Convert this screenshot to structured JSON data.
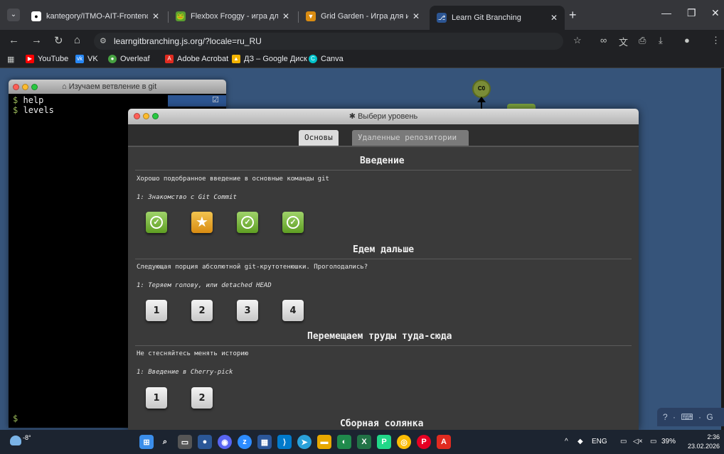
{
  "browser": {
    "tabs": [
      {
        "title": "kantegory/ITMO-AIT-Frontend",
        "icon": "github-icon"
      },
      {
        "title": "Flexbox Froggy - игра для изуч",
        "icon": "frog-icon"
      },
      {
        "title": "Grid Garden - Игра для изучен",
        "icon": "carrot-icon"
      },
      {
        "title": "Learn Git Branching",
        "icon": "git-branching-icon",
        "active": true
      }
    ],
    "url": "learngitbranching.js.org/?locale=ru_RU",
    "bookmarks": [
      {
        "label": "YouTube",
        "icon": "youtube-icon",
        "color": "#ff0000"
      },
      {
        "label": "VK",
        "icon": "vk-icon",
        "color": "#2787f5"
      },
      {
        "label": "Overleaf",
        "icon": "overleaf-icon",
        "color": "#47a141"
      },
      {
        "label": "Adobe Acrobat",
        "icon": "acrobat-icon",
        "color": "#e02b20"
      },
      {
        "label": "ДЗ – Google Диск",
        "icon": "google-drive-icon",
        "color": "#f4b400"
      },
      {
        "label": "Canva",
        "icon": "canva-icon",
        "color": "#00c4cc"
      }
    ]
  },
  "terminal": {
    "title": "Изучаем ветвление в git",
    "lines": [
      "help",
      "levels"
    ],
    "prompt": "$"
  },
  "visualization": {
    "commit_label": "C0"
  },
  "modal": {
    "title": "Выбери уровень",
    "tabs": {
      "main": "Основы",
      "remote": "Удаленные репозитории"
    },
    "sections": [
      {
        "title": "Введение",
        "description": "Хорошо подобранное введение в основные команды git",
        "current_level": "1: Знакомство с Git Commit",
        "levels": [
          {
            "state": "done",
            "label": ""
          },
          {
            "state": "star",
            "label": ""
          },
          {
            "state": "done",
            "label": ""
          },
          {
            "state": "done",
            "label": ""
          }
        ]
      },
      {
        "title": "Едем дальше",
        "description": "Следующая порция абсолютной git-крутотенюшки. Проголодались?",
        "current_level": "1: Теряем голову, или detached HEAD",
        "levels": [
          {
            "state": "num",
            "label": "1"
          },
          {
            "state": "num",
            "label": "2"
          },
          {
            "state": "num",
            "label": "3"
          },
          {
            "state": "num",
            "label": "4"
          }
        ]
      },
      {
        "title": "Перемещаем труды туда-сюда",
        "description": "Не стесняйтесь менять историю",
        "current_level": "1: Введение в Cherry-pick",
        "levels": [
          {
            "state": "num",
            "label": "1"
          },
          {
            "state": "num",
            "label": "2"
          }
        ]
      },
      {
        "title": "Сборная солянка"
      }
    ]
  },
  "help_controls": "? · ⌨ · G",
  "taskbar": {
    "weather": "-8°",
    "tray_lang": "ENG",
    "battery": "39%",
    "time": "2:36",
    "date": "23.02.2026"
  }
}
